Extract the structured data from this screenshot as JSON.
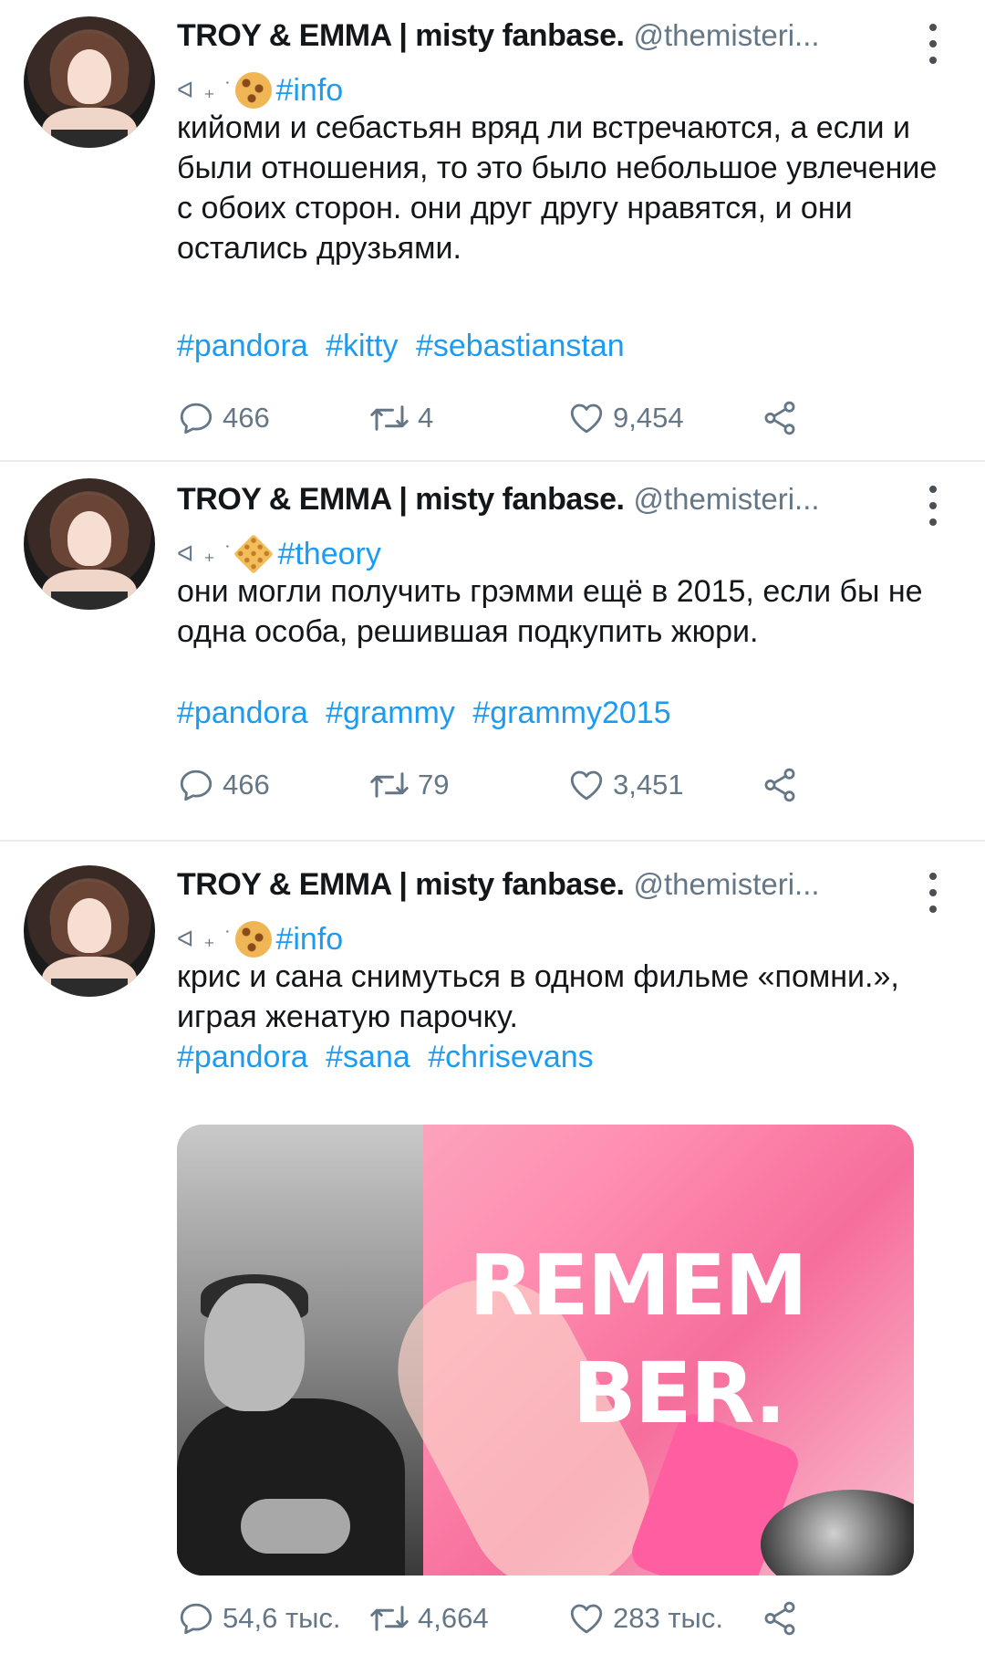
{
  "tweets": [
    {
      "author": "TROY & EMMA | misty fanbase.",
      "handle": "@themisteri...",
      "deco": "ᐊ ₊ ˙",
      "tag_emoji": "cookie",
      "tag": "#info",
      "text": "кийоми и себастьян вряд ли встречаются, а если и были отношения, то это было небольшое увлечение с обоих сторон. они друг другу нравятся, и они остались друзьями.",
      "hashtags": [
        "#pandora",
        "#kitty",
        "#sebastianstan"
      ],
      "stats": {
        "replies": "466",
        "retweets": "4",
        "likes": "9,454"
      }
    },
    {
      "author": "TROY & EMMA | misty fanbase.",
      "handle": "@themisteri...",
      "deco": "ᐊ ₊ ˙",
      "tag_emoji": "cracker",
      "tag": "#theory",
      "text": "они могли получить грэмми ещё в 2015, если бы не одна особа, решившая подкупить жюри.",
      "hashtags": [
        "#pandora",
        "#grammy",
        "#grammy2015"
      ],
      "stats": {
        "replies": "466",
        "retweets": "79",
        "likes": "3,451"
      }
    },
    {
      "author": "TROY & EMMA | misty fanbase.",
      "handle": "@themisteri...",
      "deco": "ᐊ ₊ ˙",
      "tag_emoji": "cookie",
      "tag": "#info",
      "text": "крис и сана снимуться в одном фильме «помни.», играя женатую парочку.",
      "hashtags": [
        "#pandora",
        "#sana",
        "#chrisevans"
      ],
      "media": {
        "title_line1": "REMEM",
        "title_line2": "BER."
      },
      "stats": {
        "replies": "54,6 тыс.",
        "retweets": "4,664",
        "likes": "283 тыс."
      }
    }
  ],
  "icons": {
    "reply": "reply-icon",
    "retweet": "retweet-icon",
    "like": "heart-icon",
    "share": "share-icon",
    "more": "more-vertical-icon"
  },
  "colors": {
    "link": "#1d9bf0",
    "muted": "#657786",
    "text": "#14171a",
    "divider": "#e6ecf0"
  }
}
